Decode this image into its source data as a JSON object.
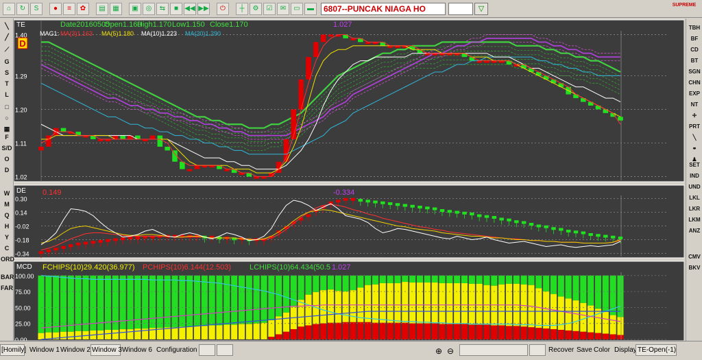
{
  "toolbar": {
    "symbol": "6807--PUNCAK NIAGA HO",
    "logo": "SUPREME"
  },
  "left_tools": [
    "G",
    "S",
    "T",
    "L",
    "F",
    "S/D",
    "O",
    "D",
    "W",
    "M",
    "Q",
    "H",
    "Y",
    "C",
    "ORD",
    "BAR",
    "FAR"
  ],
  "right_tools": [
    "TBH",
    "BF",
    "CD",
    "BT",
    "SGN",
    "CHN",
    "EXP",
    "NT",
    "PRT",
    "SET",
    "IND",
    "UND",
    "LKL",
    "LKR",
    "LKM",
    "ANZ",
    "CMV",
    "BKV"
  ],
  "status": {
    "homily": "[Homily]",
    "windows": [
      "Window 1",
      "Window 2",
      "Window 3",
      "Window 6"
    ],
    "configuration": "Configuration",
    "recover": "Recover",
    "save": "Save",
    "color": "Color",
    "display": "Display",
    "mode": "TE-Open(-1)"
  },
  "chart_data": [
    {
      "type": "candlestick",
      "panel_label": "TE",
      "period_badge": "D",
      "header": {
        "date": "Date20160505",
        "open": "Open1.160",
        "high": "High1.170",
        "low": "Low1.150",
        "close": "Close1.170"
      },
      "peak_label": "1.027",
      "ma_header": {
        "prefix": "MAG1:",
        "ma3": "MA(3)1.163",
        "ma5": "MA(5)1.180",
        "ma10": "MA(10)1.223",
        "ma20": "MA(20)1.290"
      },
      "y_ticks": [
        "1.40",
        "1.29",
        "1.20",
        "1.11",
        "1.02"
      ],
      "ylim": [
        1.01,
        1.41
      ],
      "close": [
        1.1,
        1.13,
        1.15,
        1.14,
        1.14,
        1.13,
        1.13,
        1.12,
        1.12,
        1.12,
        1.13,
        1.12,
        1.13,
        1.12,
        1.12,
        1.13,
        1.1,
        1.09,
        1.06,
        1.04,
        1.04,
        1.05,
        1.05,
        1.05,
        1.04,
        1.04,
        1.03,
        1.03,
        1.02,
        1.02,
        1.02,
        1.03,
        1.06,
        1.12,
        1.2,
        1.28,
        1.34,
        1.38,
        1.4,
        1.4,
        1.4,
        1.39,
        1.39,
        1.38,
        1.38,
        1.38,
        1.37,
        1.37,
        1.37,
        1.37,
        1.36,
        1.35,
        1.35,
        1.35,
        1.35,
        1.35,
        1.35,
        1.34,
        1.33,
        1.33,
        1.33,
        1.33,
        1.33,
        1.32,
        1.32,
        1.31,
        1.3,
        1.29,
        1.28,
        1.27,
        1.26,
        1.24,
        1.23,
        1.22,
        1.21,
        1.2,
        1.19,
        1.18,
        1.17
      ],
      "ma3": [
        1.11,
        1.12,
        1.14,
        1.14,
        1.14,
        1.13,
        1.13,
        1.13,
        1.12,
        1.12,
        1.12,
        1.12,
        1.12,
        1.12,
        1.12,
        1.12,
        1.12,
        1.11,
        1.08,
        1.06,
        1.05,
        1.05,
        1.05,
        1.05,
        1.05,
        1.04,
        1.04,
        1.03,
        1.03,
        1.02,
        1.02,
        1.02,
        1.04,
        1.07,
        1.13,
        1.2,
        1.27,
        1.33,
        1.37,
        1.39,
        1.4,
        1.4,
        1.39,
        1.39,
        1.38,
        1.38,
        1.38,
        1.37,
        1.37,
        1.37,
        1.37,
        1.36,
        1.35,
        1.35,
        1.35,
        1.35,
        1.35,
        1.35,
        1.34,
        1.33,
        1.33,
        1.33,
        1.33,
        1.33,
        1.32,
        1.32,
        1.31,
        1.3,
        1.29,
        1.28,
        1.27,
        1.26,
        1.24,
        1.23,
        1.22,
        1.21,
        1.2,
        1.19,
        1.16
      ],
      "ma5": [
        1.12,
        1.12,
        1.13,
        1.13,
        1.13,
        1.13,
        1.13,
        1.13,
        1.13,
        1.13,
        1.12,
        1.12,
        1.12,
        1.12,
        1.12,
        1.12,
        1.12,
        1.12,
        1.1,
        1.08,
        1.06,
        1.05,
        1.05,
        1.05,
        1.05,
        1.05,
        1.04,
        1.04,
        1.04,
        1.03,
        1.03,
        1.03,
        1.04,
        1.06,
        1.1,
        1.15,
        1.22,
        1.29,
        1.33,
        1.35,
        1.36,
        1.36,
        1.37,
        1.37,
        1.37,
        1.37,
        1.37,
        1.37,
        1.37,
        1.37,
        1.36,
        1.36,
        1.36,
        1.36,
        1.35,
        1.35,
        1.35,
        1.35,
        1.34,
        1.34,
        1.34,
        1.33,
        1.33,
        1.33,
        1.32,
        1.31,
        1.3,
        1.29,
        1.28,
        1.27,
        1.26,
        1.25,
        1.24,
        1.23,
        1.22,
        1.21,
        1.2,
        1.19,
        1.18
      ],
      "ma10": [
        1.16,
        1.15,
        1.14,
        1.13,
        1.13,
        1.13,
        1.13,
        1.13,
        1.13,
        1.13,
        1.13,
        1.13,
        1.13,
        1.12,
        1.12,
        1.12,
        1.12,
        1.12,
        1.11,
        1.1,
        1.09,
        1.08,
        1.07,
        1.07,
        1.07,
        1.06,
        1.06,
        1.05,
        1.05,
        1.04,
        1.04,
        1.04,
        1.04,
        1.05,
        1.07,
        1.09,
        1.12,
        1.16,
        1.21,
        1.25,
        1.28,
        1.3,
        1.32,
        1.33,
        1.33,
        1.34,
        1.34,
        1.34,
        1.34,
        1.34,
        1.35,
        1.35,
        1.35,
        1.35,
        1.35,
        1.35,
        1.35,
        1.35,
        1.35,
        1.35,
        1.35,
        1.34,
        1.34,
        1.34,
        1.33,
        1.32,
        1.31,
        1.31,
        1.3,
        1.29,
        1.28,
        1.27,
        1.26,
        1.26,
        1.25,
        1.24,
        1.23,
        1.23,
        1.22
      ],
      "ma20": [
        1.27,
        1.26,
        1.25,
        1.24,
        1.23,
        1.22,
        1.21,
        1.2,
        1.19,
        1.18,
        1.18,
        1.17,
        1.16,
        1.16,
        1.15,
        1.15,
        1.14,
        1.14,
        1.13,
        1.13,
        1.12,
        1.12,
        1.11,
        1.11,
        1.1,
        1.1,
        1.09,
        1.09,
        1.08,
        1.08,
        1.08,
        1.08,
        1.08,
        1.08,
        1.09,
        1.1,
        1.11,
        1.12,
        1.13,
        1.15,
        1.16,
        1.17,
        1.19,
        1.2,
        1.21,
        1.22,
        1.23,
        1.24,
        1.25,
        1.26,
        1.27,
        1.28,
        1.29,
        1.3,
        1.3,
        1.31,
        1.32,
        1.32,
        1.33,
        1.33,
        1.34,
        1.34,
        1.34,
        1.34,
        1.34,
        1.34,
        1.34,
        1.33,
        1.33,
        1.32,
        1.32,
        1.31,
        1.31,
        1.3,
        1.3,
        1.29,
        1.29,
        1.29,
        1.29
      ],
      "band_top": [
        1.38,
        1.38,
        1.37,
        1.36,
        1.35,
        1.34,
        1.33,
        1.32,
        1.31,
        1.3,
        1.29,
        1.28,
        1.27,
        1.26,
        1.25,
        1.24,
        1.23,
        1.22,
        1.21,
        1.2,
        1.19,
        1.18,
        1.18,
        1.17,
        1.17,
        1.16,
        1.16,
        1.16,
        1.15,
        1.15,
        1.15,
        1.16,
        1.16,
        1.17,
        1.18,
        1.19,
        1.21,
        1.23,
        1.25,
        1.27,
        1.29,
        1.3,
        1.31,
        1.32,
        1.33,
        1.34,
        1.35,
        1.35,
        1.36,
        1.36,
        1.37,
        1.37,
        1.37,
        1.37,
        1.38,
        1.38,
        1.38,
        1.38,
        1.38,
        1.38,
        1.38,
        1.38,
        1.38,
        1.38,
        1.37,
        1.37,
        1.37,
        1.37,
        1.36,
        1.36,
        1.35,
        1.35,
        1.34,
        1.34,
        1.33,
        1.33,
        1.32,
        1.31,
        1.3
      ]
    },
    {
      "type": "bar",
      "panel_label": "DE",
      "value_label": "0.149",
      "peak_label": "-0.334",
      "y_ticks": [
        "0.30",
        "0.14",
        "-0.02",
        "-0.18",
        "-0.34"
      ],
      "ylim": [
        -0.36,
        0.32
      ],
      "values": [
        -0.33,
        -0.31,
        -0.29,
        -0.27,
        -0.25,
        -0.23,
        -0.22,
        -0.21,
        -0.2,
        -0.19,
        -0.18,
        -0.17,
        -0.16,
        -0.16,
        -0.15,
        -0.15,
        -0.14,
        -0.14,
        -0.14,
        -0.14,
        -0.14,
        -0.14,
        -0.15,
        -0.15,
        -0.16,
        -0.16,
        -0.17,
        -0.17,
        -0.18,
        -0.18,
        -0.18,
        -0.15,
        -0.09,
        -0.04,
        0.02,
        0.06,
        0.1,
        0.16,
        0.2,
        0.25,
        0.27,
        0.29,
        0.29,
        0.28,
        0.27,
        0.26,
        0.25,
        0.24,
        0.23,
        0.22,
        0.21,
        0.2,
        0.19,
        0.18,
        0.16,
        0.15,
        0.14,
        0.13,
        0.12,
        0.1,
        0.09,
        0.08,
        0.06,
        0.05,
        0.03,
        0.02,
        0.0,
        -0.02,
        -0.03,
        -0.05,
        -0.06,
        -0.08,
        -0.09,
        -0.1,
        -0.12,
        -0.13,
        -0.14,
        -0.15,
        -0.16
      ],
      "white_line": [
        -0.24,
        -0.18,
        -0.1,
        0.05,
        0.18,
        0.17,
        0.15,
        0.1,
        0.02,
        -0.05,
        -0.1,
        -0.15,
        -0.14,
        -0.12,
        -0.08,
        -0.06,
        -0.1,
        -0.14,
        -0.15,
        -0.12,
        -0.1,
        -0.12,
        -0.15,
        -0.17,
        -0.14,
        -0.1,
        -0.12,
        -0.15,
        -0.19,
        -0.18,
        -0.14,
        -0.05,
        0.1,
        0.22,
        0.28,
        0.26,
        0.22,
        0.16,
        0.2,
        0.24,
        0.18,
        0.1,
        0.08,
        0.06,
        0.02,
        -0.05,
        -0.1,
        -0.08,
        -0.05,
        -0.06,
        -0.08,
        -0.1,
        -0.12,
        -0.14,
        -0.16,
        -0.17,
        -0.14,
        -0.16,
        -0.18,
        -0.17,
        -0.15,
        -0.18,
        -0.2,
        -0.22,
        -0.21,
        -0.2,
        -0.22,
        -0.24,
        -0.26,
        -0.25,
        -0.24,
        -0.26,
        -0.27,
        -0.26,
        -0.25,
        -0.26,
        -0.25,
        -0.24,
        -0.2
      ],
      "yellow_line": [
        -0.22,
        -0.2,
        -0.16,
        -0.1,
        -0.05,
        -0.03,
        -0.02,
        -0.04,
        -0.06,
        -0.08,
        -0.1,
        -0.12,
        -0.13,
        -0.13,
        -0.12,
        -0.12,
        -0.13,
        -0.14,
        -0.15,
        -0.15,
        -0.14,
        -0.14,
        -0.15,
        -0.16,
        -0.16,
        -0.16,
        -0.16,
        -0.17,
        -0.18,
        -0.18,
        -0.17,
        -0.14,
        -0.09,
        -0.03,
        0.04,
        0.1,
        0.14,
        0.16,
        0.17,
        0.16,
        0.14,
        0.12,
        0.1,
        0.08,
        0.06,
        0.04,
        0.02,
        0.0,
        -0.02,
        -0.03,
        -0.05,
        -0.06,
        -0.07,
        -0.08,
        -0.1,
        -0.11,
        -0.12,
        -0.13,
        -0.14,
        -0.14,
        -0.15,
        -0.16,
        -0.16,
        -0.17,
        -0.18,
        -0.18,
        -0.19,
        -0.19,
        -0.2,
        -0.2,
        -0.21,
        -0.21,
        -0.21,
        -0.22,
        -0.22,
        -0.22,
        -0.22,
        -0.21,
        -0.18
      ],
      "red_line": [
        -0.3,
        -0.28,
        -0.25,
        -0.21,
        -0.17,
        -0.14,
        -0.11,
        -0.1,
        -0.1,
        -0.11,
        -0.12,
        -0.13,
        -0.14,
        -0.14,
        -0.14,
        -0.14,
        -0.14,
        -0.14,
        -0.15,
        -0.15,
        -0.15,
        -0.15,
        -0.15,
        -0.16,
        -0.16,
        -0.16,
        -0.16,
        -0.17,
        -0.17,
        -0.18,
        -0.18,
        -0.16,
        -0.12,
        -0.06,
        0.01,
        0.08,
        0.14,
        0.19,
        0.22,
        0.23,
        0.22,
        0.2,
        0.17,
        0.15,
        0.12,
        0.1,
        0.07,
        0.05,
        0.03,
        0.01,
        -0.01,
        -0.03,
        -0.04,
        -0.06,
        -0.07,
        -0.09,
        -0.1,
        -0.11,
        -0.12,
        -0.13,
        -0.14,
        -0.15,
        -0.16,
        -0.17,
        -0.17,
        -0.18,
        -0.19,
        -0.19,
        -0.2,
        -0.2,
        -0.21,
        -0.21,
        -0.21,
        -0.22,
        -0.22,
        -0.22,
        -0.22,
        -0.21,
        -0.19
      ]
    },
    {
      "type": "bar",
      "panel_label": "MCD",
      "legend": {
        "fchips": "FCHIPS(10)29.420(36.977)",
        "pchips": "PCHIPS(10)6.144(12.503)",
        "lchips": "LCHIPS(10)64.434(50.5",
        "peak": "1.027"
      },
      "y_ticks": [
        "100.00",
        "75.00",
        "50.00",
        "25.00",
        "0.00"
      ],
      "ylim": [
        0,
        103
      ],
      "stack_top": 100,
      "red": [
        0,
        0,
        0,
        0,
        0,
        0,
        0,
        0,
        0,
        0,
        0,
        0,
        0,
        0,
        0,
        0,
        0,
        0,
        0,
        0,
        0,
        0,
        0,
        0,
        0,
        0,
        0,
        0,
        0,
        0,
        0,
        4,
        8,
        12,
        16,
        20,
        22,
        24,
        25,
        26,
        26,
        27,
        27,
        27,
        27,
        26,
        26,
        26,
        26,
        26,
        25,
        25,
        25,
        25,
        24,
        24,
        24,
        24,
        23,
        23,
        23,
        22,
        22,
        21,
        21,
        20,
        19,
        18,
        17,
        16,
        15,
        14,
        13,
        12,
        11,
        10,
        9,
        8,
        7
      ],
      "yellow": [
        10,
        11,
        11,
        12,
        12,
        13,
        13,
        14,
        14,
        15,
        15,
        16,
        16,
        17,
        17,
        18,
        18,
        19,
        19,
        20,
        20,
        21,
        21,
        22,
        22,
        23,
        23,
        24,
        24,
        25,
        26,
        26,
        28,
        30,
        35,
        42,
        48,
        50,
        52,
        52,
        50,
        48,
        50,
        54,
        58,
        60,
        62,
        62,
        62,
        64,
        64,
        64,
        64,
        64,
        64,
        64,
        64,
        64,
        64,
        64,
        62,
        62,
        64,
        66,
        66,
        66,
        66,
        62,
        58,
        55,
        52,
        50,
        48,
        45,
        42,
        38,
        34,
        30,
        28
      ],
      "cyan_line": [
        100,
        99,
        98,
        97,
        96,
        95,
        95,
        94,
        94,
        94,
        94,
        94,
        94,
        94,
        94,
        93,
        93,
        93,
        93,
        92,
        92,
        91,
        90,
        89,
        88,
        86,
        84,
        82,
        80,
        78,
        76,
        73,
        70,
        66,
        62,
        58,
        54,
        50,
        46,
        43,
        40,
        38,
        36,
        34,
        33,
        32,
        31,
        30,
        29,
        28,
        28,
        27,
        27,
        26,
        26,
        25,
        25,
        25,
        24,
        24,
        24,
        24,
        24,
        24,
        23,
        23,
        23,
        22,
        22,
        22,
        23,
        25,
        28,
        32,
        36,
        40,
        44,
        48,
        52
      ],
      "magenta_line": [
        18,
        19,
        20,
        21,
        22,
        23,
        24,
        25,
        26,
        27,
        28,
        29,
        30,
        31,
        32,
        33,
        34,
        35,
        36,
        37,
        38,
        39,
        40,
        41,
        42,
        43,
        44,
        45,
        46,
        47,
        48,
        49,
        50,
        51,
        52,
        52,
        53,
        53,
        54,
        54,
        54,
        54,
        54,
        54,
        54,
        54,
        54,
        54,
        54,
        54,
        54,
        54,
        54,
        54,
        54,
        54,
        54,
        54,
        54,
        54,
        54,
        54,
        54,
        54,
        54,
        53,
        52,
        50,
        48,
        46,
        44,
        42,
        40,
        38,
        36,
        34,
        32,
        30,
        28
      ],
      "blue_line": [
        0,
        1,
        2,
        3,
        4,
        5,
        6,
        7,
        8,
        9,
        10,
        11,
        12,
        13,
        14,
        15,
        16,
        17,
        18,
        19,
        20,
        21,
        22,
        23,
        24,
        25,
        26,
        27,
        28,
        29,
        30,
        31,
        32,
        33,
        34,
        35,
        36,
        37,
        38,
        39,
        40,
        41,
        42,
        43,
        44,
        44,
        44,
        44,
        44,
        44,
        44,
        44,
        44,
        44,
        44,
        44,
        44,
        44,
        44,
        44,
        44,
        44,
        44,
        44,
        44,
        44,
        44,
        44,
        44,
        44,
        44,
        44,
        44,
        44,
        44,
        44,
        44,
        44,
        44
      ]
    }
  ],
  "colors": {
    "bg": "#3c3c3c",
    "up": "#e00000",
    "down": "#20e020",
    "ma3": "#ff3030",
    "ma5": "#f0e000",
    "ma10": "#ffffff",
    "ma20": "#30b8d8",
    "band": "#40d040",
    "violet": "#c040f0",
    "frame": "#ffffff",
    "grid": "#888888",
    "tick": "#ffffff"
  }
}
